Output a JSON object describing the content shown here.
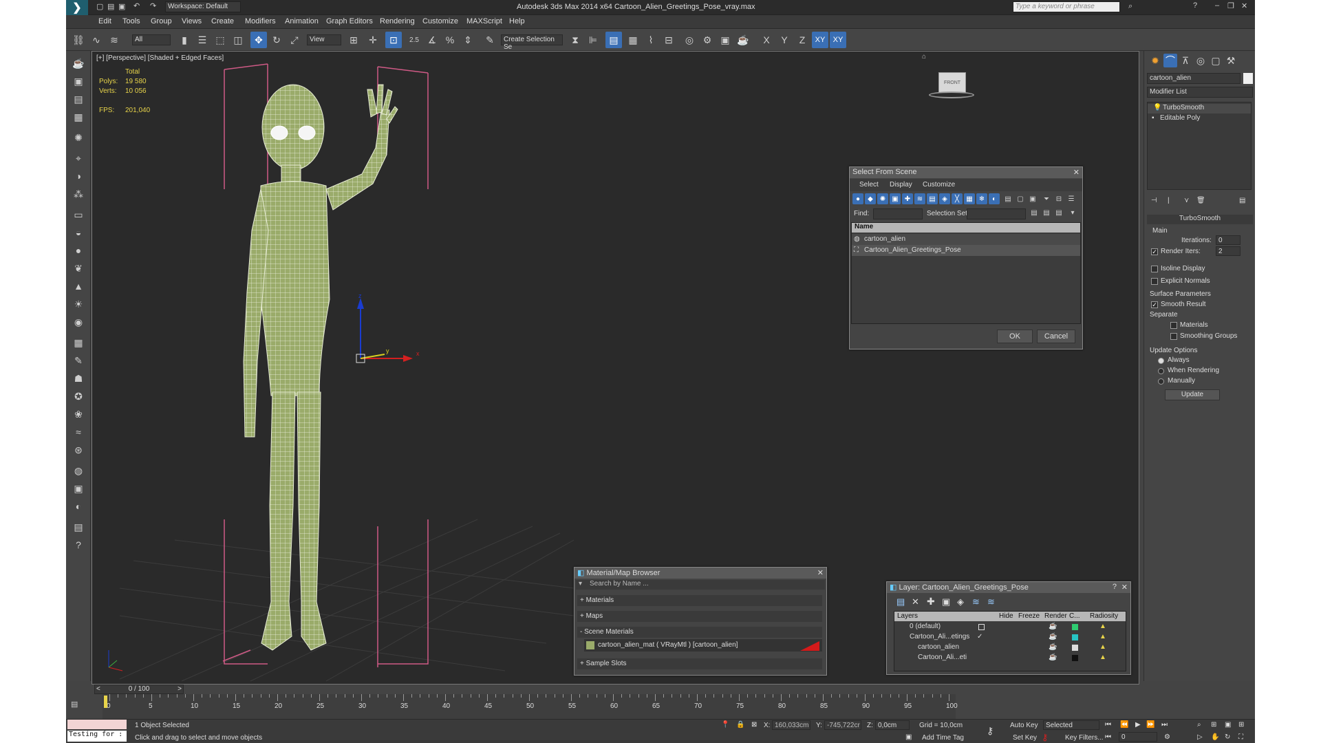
{
  "titlebar": {
    "title": "Autodesk 3ds Max  2014 x64     Cartoon_Alien_Greetings_Pose_vray.max",
    "workspace": "Workspace: Default",
    "search_placeholder": "Type a keyword or phrase"
  },
  "menu": [
    "Edit",
    "Tools",
    "Group",
    "Views",
    "Create",
    "Modifiers",
    "Animation",
    "Graph Editors",
    "Rendering",
    "Customize",
    "MAXScript",
    "Help"
  ],
  "toolbar": {
    "filter": "All",
    "view": "View",
    "selection_set": "Create Selection Se",
    "axis_labels": [
      "X",
      "Y",
      "Z",
      "XY",
      "XY"
    ],
    "snap_labels": [
      "2.5",
      "%"
    ]
  },
  "viewport": {
    "label": "[+] [Perspective] [Shaded + Edged Faces]",
    "stats": {
      "total": "Total",
      "polys_label": "Polys:",
      "polys": "19 580",
      "verts_label": "Verts:",
      "verts": "10 056",
      "fps_label": "FPS:",
      "fps": "201,040"
    },
    "gizmo": {
      "z": "z",
      "y": "y",
      "x": "x"
    },
    "viewcube_label": "FRONT"
  },
  "select_from_scene": {
    "title": "Select From Scene",
    "menu": [
      "Select",
      "Display",
      "Customize"
    ],
    "find_label": "Find:",
    "selection_set_label": "Selection Set:",
    "column_name": "Name",
    "items": [
      "cartoon_alien",
      "Cartoon_Alien_Greetings_Pose"
    ],
    "ok": "OK",
    "cancel": "Cancel"
  },
  "material_browser": {
    "title": "Material/Map Browser",
    "search_placeholder": "Search by Name ...",
    "sections": [
      "+ Materials",
      "+ Maps",
      "- Scene Materials",
      "+ Sample Slots"
    ],
    "scene_material": "cartoon_alien_mat  ( VRayMtl )  [cartoon_alien]"
  },
  "layer_dialog": {
    "title": "Layer: Cartoon_Alien_Greetings_Pose",
    "columns": [
      "Layers",
      "Hide",
      "Freeze",
      "Render",
      "C...",
      "Radiosity"
    ],
    "rows": [
      {
        "name": "0 (default)",
        "color": "#2ecc71"
      },
      {
        "name": "Cartoon_Ali...etings",
        "color": "#27c4c4"
      },
      {
        "name": "cartoon_alien",
        "color": "#dddddd"
      },
      {
        "name": "Cartoon_Ali...eti",
        "color": "#111111"
      }
    ]
  },
  "command_panel": {
    "object_name": "cartoon_alien",
    "modifier_list": "Modifier List",
    "stack": [
      "TurboSmooth",
      "Editable Poly"
    ],
    "rollout_title": "TurboSmooth",
    "main_label": "Main",
    "iterations_label": "Iterations:",
    "iterations": "0",
    "render_iters_label": "Render Iters:",
    "render_iters": "2",
    "isoline_display": "Isoline Display",
    "explicit_normals": "Explicit Normals",
    "surface_params": "Surface Parameters",
    "smooth_result": "Smooth Result",
    "separate": "Separate",
    "materials": "Materials",
    "smoothing_groups": "Smoothing Groups",
    "update_options": "Update Options",
    "always": "Always",
    "when_rendering": "When Rendering",
    "manually": "Manually",
    "update_btn": "Update"
  },
  "timeline": {
    "frame": "0 / 100",
    "ticks": [
      "0",
      "5",
      "10",
      "15",
      "20",
      "25",
      "30",
      "35",
      "40",
      "45",
      "50",
      "55",
      "60",
      "65",
      "70",
      "75",
      "80",
      "85",
      "90",
      "95",
      "100"
    ]
  },
  "status": {
    "maxscript": "Testing for :",
    "selected": "1 Object Selected",
    "prompt": "Click and drag to select and move objects",
    "x_label": "X:",
    "x": "160,033cm",
    "y_label": "Y:",
    "y": "-745,722cr",
    "z_label": "Z:",
    "z": "0,0cm",
    "grid": "Grid = 10,0cm",
    "add_time_tag": "Add Time Tag",
    "auto_key": "Auto Key",
    "set_key": "Set Key",
    "selected_dropdown": "Selected",
    "key_filters": "Key Filters...",
    "frame_field": "0"
  },
  "colors": {
    "accent": "#3a6fb5",
    "mesh": "#9aab6a",
    "bbox": "#d05a86"
  }
}
